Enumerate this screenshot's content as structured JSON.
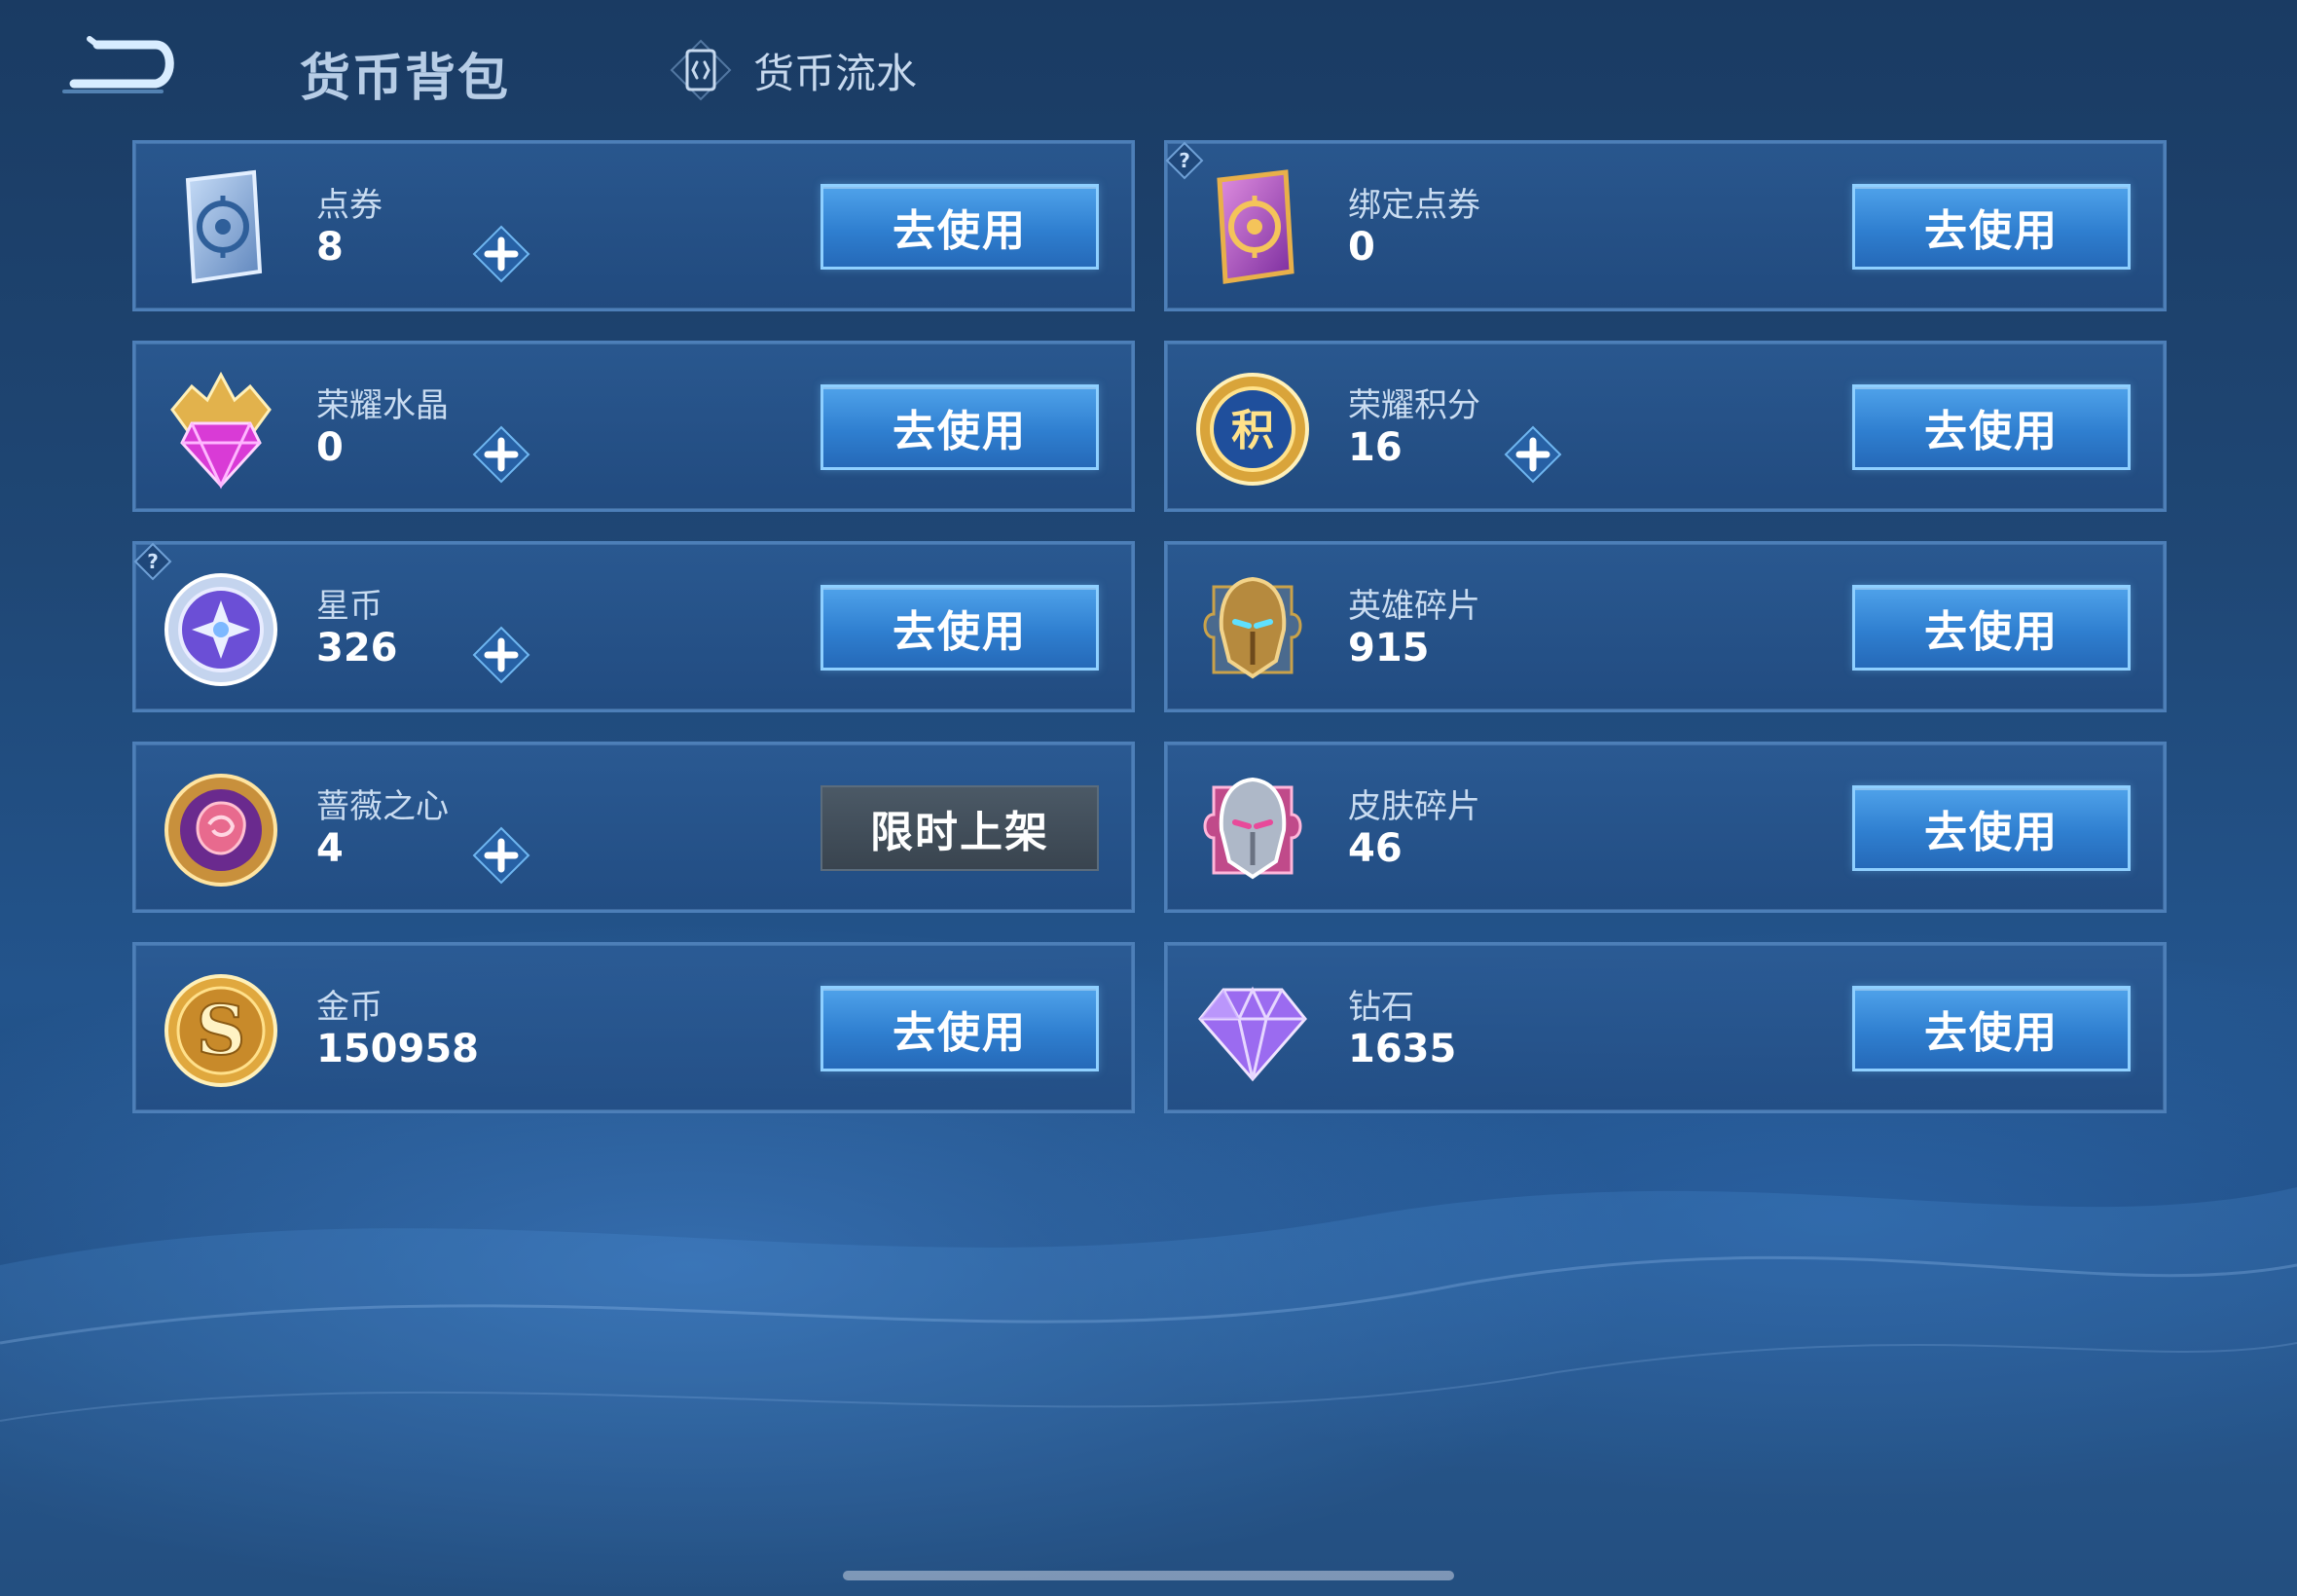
{
  "header": {
    "title": "货币背包",
    "ledger_tab_label": "货币流水"
  },
  "cards": [
    {
      "name": "点券",
      "value": "8",
      "icon": "voucher-icon",
      "has_plus": true,
      "has_help": false,
      "action": "去使用"
    },
    {
      "name": "绑定点券",
      "value": "0",
      "icon": "bound-voucher-icon",
      "has_plus": false,
      "has_help": true,
      "action": "去使用"
    },
    {
      "name": "荣耀水晶",
      "value": "0",
      "icon": "glory-crystal-icon",
      "has_plus": true,
      "has_help": false,
      "action": "去使用"
    },
    {
      "name": "荣耀积分",
      "value": "16",
      "icon": "glory-points-icon",
      "has_plus": true,
      "has_help": false,
      "action": "去使用"
    },
    {
      "name": "星币",
      "value": "326",
      "icon": "star-coin-icon",
      "has_plus": true,
      "has_help": true,
      "action": "去使用"
    },
    {
      "name": "英雄碎片",
      "value": "915",
      "icon": "hero-fragment-icon",
      "has_plus": false,
      "has_help": false,
      "action": "去使用"
    },
    {
      "name": "蔷薇之心",
      "value": "4",
      "icon": "rose-heart-icon",
      "has_plus": true,
      "has_help": false,
      "action": "限时上架"
    },
    {
      "name": "皮肤碎片",
      "value": "46",
      "icon": "skin-fragment-icon",
      "has_plus": false,
      "has_help": false,
      "action": "去使用"
    },
    {
      "name": "金币",
      "value": "150958",
      "icon": "gold-coin-icon",
      "has_plus": false,
      "has_help": false,
      "action": "去使用"
    },
    {
      "name": "钻石",
      "value": "1635",
      "icon": "diamond-icon",
      "has_plus": false,
      "has_help": false,
      "action": "去使用"
    }
  ],
  "colors": {
    "background": "#1f4775",
    "card_border": "#4d7fb8",
    "use_button": "#2f7fd0",
    "limited_button": "#39444f"
  }
}
